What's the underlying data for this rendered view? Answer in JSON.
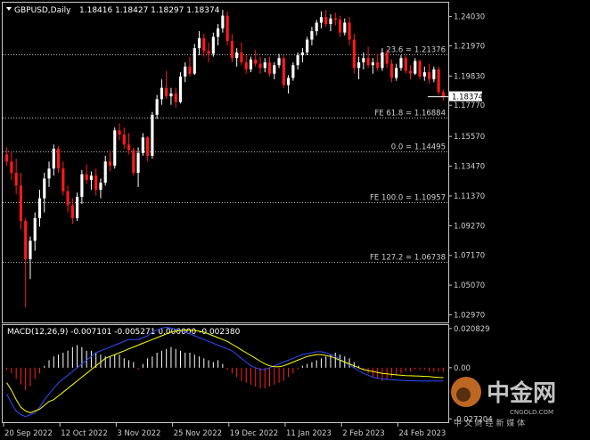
{
  "window": {
    "symbol_line": "GBPUSD,Daily",
    "ohlc": "1.18416 1.18427 1.18297 1.18374",
    "current_price": "1.18374"
  },
  "colors": {
    "background": "#000000",
    "bull_candle": "#ffffff",
    "bear_candle": "#ff1a1a",
    "grid": "#c8c8c8",
    "macd_hist_pos": "#ffffff",
    "macd_hist_neg": "#ff2020",
    "macd_signal": "#ffff00",
    "macd_line": "#2a4dff",
    "fib_line": "#bdbdbd"
  },
  "price_axis": {
    "ticks": [
      "1.24030",
      "1.21970",
      "1.19830",
      "1.17770",
      "1.15570",
      "1.13470",
      "1.11370",
      "1.09270",
      "1.07170",
      "1.05070",
      "1.02970"
    ],
    "range": [
      1.025,
      1.2495
    ]
  },
  "levels": [
    {
      "label": "23.6 = 1.21376",
      "value": 1.21376
    },
    {
      "label": "FE 61.8 = 1.16884",
      "value": 1.16884
    },
    {
      "label": "0.0 = 1.14495",
      "value": 1.14495
    },
    {
      "label": "FE 100.0 = 1.10957",
      "value": 1.10957
    },
    {
      "label": "FE 127.2 = 1.06738",
      "value": 1.06738
    }
  ],
  "macd": {
    "label": "MACD(12,26,9) -0.007101 -0.005271 0.000000 -0.002380",
    "ticks": [
      "0.020829",
      "0.00",
      "-0.027204"
    ],
    "range": [
      -0.0285,
      0.0222
    ]
  },
  "time_axis": {
    "labels": [
      "20 Sep 2022",
      "12 Oct 2022",
      "3 Nov 2022",
      "25 Nov 2022",
      "19 Dec 2022",
      "11 Jan 2023",
      "2 Feb 2023",
      "24 Feb 2023"
    ]
  },
  "watermark": {
    "logo_text": "中金网",
    "url_text": "CNGOLD.COM",
    "sub_text": "中 文 财 经 新 媒 体"
  },
  "chart_data": {
    "type": "candlestick",
    "bars": [
      [
        1.143,
        1.148,
        1.135,
        1.138
      ],
      [
        1.138,
        1.145,
        1.125,
        1.13
      ],
      [
        1.13,
        1.14,
        1.115,
        1.121
      ],
      [
        1.121,
        1.13,
        1.09,
        1.096
      ],
      [
        1.096,
        1.098,
        1.035,
        1.069
      ],
      [
        1.069,
        1.085,
        1.055,
        1.082
      ],
      [
        1.082,
        1.102,
        1.075,
        1.098
      ],
      [
        1.098,
        1.118,
        1.092,
        1.112
      ],
      [
        1.112,
        1.13,
        1.102,
        1.126
      ],
      [
        1.126,
        1.138,
        1.12,
        1.133
      ],
      [
        1.133,
        1.15,
        1.128,
        1.147
      ],
      [
        1.147,
        1.149,
        1.13,
        1.133
      ],
      [
        1.133,
        1.138,
        1.114,
        1.117
      ],
      [
        1.117,
        1.121,
        1.102,
        1.107
      ],
      [
        1.107,
        1.112,
        1.094,
        1.098
      ],
      [
        1.098,
        1.116,
        1.096,
        1.113
      ],
      [
        1.113,
        1.132,
        1.108,
        1.129
      ],
      [
        1.129,
        1.136,
        1.122,
        1.125
      ],
      [
        1.125,
        1.131,
        1.118,
        1.128
      ],
      [
        1.128,
        1.133,
        1.114,
        1.118
      ],
      [
        1.118,
        1.126,
        1.112,
        1.123
      ],
      [
        1.123,
        1.142,
        1.121,
        1.138
      ],
      [
        1.138,
        1.146,
        1.131,
        1.135
      ],
      [
        1.135,
        1.162,
        1.133,
        1.16
      ],
      [
        1.16,
        1.165,
        1.153,
        1.157
      ],
      [
        1.157,
        1.162,
        1.147,
        1.15
      ],
      [
        1.15,
        1.158,
        1.143,
        1.146
      ],
      [
        1.146,
        1.148,
        1.128,
        1.13
      ],
      [
        1.13,
        1.148,
        1.12,
        1.144
      ],
      [
        1.144,
        1.158,
        1.142,
        1.155
      ],
      [
        1.155,
        1.156,
        1.138,
        1.142
      ],
      [
        1.142,
        1.173,
        1.14,
        1.171
      ],
      [
        1.171,
        1.185,
        1.168,
        1.182
      ],
      [
        1.182,
        1.196,
        1.178,
        1.19
      ],
      [
        1.19,
        1.202,
        1.182,
        1.184
      ],
      [
        1.184,
        1.19,
        1.178,
        1.186
      ],
      [
        1.186,
        1.19,
        1.176,
        1.18
      ],
      [
        1.18,
        1.201,
        1.179,
        1.198
      ],
      [
        1.198,
        1.208,
        1.194,
        1.205
      ],
      [
        1.205,
        1.212,
        1.198,
        1.2
      ],
      [
        1.2,
        1.221,
        1.199,
        1.218
      ],
      [
        1.218,
        1.23,
        1.213,
        1.225
      ],
      [
        1.225,
        1.228,
        1.212,
        1.216
      ],
      [
        1.216,
        1.222,
        1.208,
        1.214
      ],
      [
        1.214,
        1.229,
        1.212,
        1.226
      ],
      [
        1.226,
        1.235,
        1.22,
        1.232
      ],
      [
        1.232,
        1.245,
        1.229,
        1.241
      ],
      [
        1.241,
        1.244,
        1.22,
        1.223
      ],
      [
        1.223,
        1.228,
        1.208,
        1.211
      ],
      [
        1.211,
        1.218,
        1.205,
        1.215
      ],
      [
        1.215,
        1.222,
        1.206,
        1.208
      ],
      [
        1.208,
        1.213,
        1.2,
        1.203
      ],
      [
        1.203,
        1.212,
        1.201,
        1.21
      ],
      [
        1.21,
        1.217,
        1.205,
        1.207
      ],
      [
        1.207,
        1.212,
        1.2,
        1.204
      ],
      [
        1.204,
        1.211,
        1.201,
        1.208
      ],
      [
        1.208,
        1.212,
        1.198,
        1.2
      ],
      [
        1.2,
        1.208,
        1.196,
        1.206
      ],
      [
        1.206,
        1.214,
        1.204,
        1.211
      ],
      [
        1.211,
        1.213,
        1.19,
        1.192
      ],
      [
        1.192,
        1.199,
        1.186,
        1.197
      ],
      [
        1.197,
        1.208,
        1.195,
        1.206
      ],
      [
        1.206,
        1.215,
        1.203,
        1.213
      ],
      [
        1.213,
        1.218,
        1.208,
        1.215
      ],
      [
        1.215,
        1.226,
        1.213,
        1.224
      ],
      [
        1.224,
        1.233,
        1.22,
        1.23
      ],
      [
        1.23,
        1.238,
        1.227,
        1.236
      ],
      [
        1.236,
        1.244,
        1.232,
        1.24
      ],
      [
        1.24,
        1.245,
        1.233,
        1.235
      ],
      [
        1.235,
        1.242,
        1.23,
        1.239
      ],
      [
        1.239,
        1.243,
        1.234,
        1.238
      ],
      [
        1.238,
        1.241,
        1.226,
        1.229
      ],
      [
        1.229,
        1.239,
        1.227,
        1.236
      ],
      [
        1.236,
        1.24,
        1.22,
        1.224
      ],
      [
        1.224,
        1.228,
        1.2,
        1.204
      ],
      [
        1.204,
        1.212,
        1.196,
        1.208
      ],
      [
        1.208,
        1.215,
        1.203,
        1.211
      ],
      [
        1.211,
        1.219,
        1.204,
        1.206
      ],
      [
        1.206,
        1.211,
        1.2,
        1.208
      ],
      [
        1.208,
        1.214,
        1.202,
        1.204
      ],
      [
        1.204,
        1.218,
        1.202,
        1.215
      ],
      [
        1.215,
        1.217,
        1.204,
        1.207
      ],
      [
        1.207,
        1.21,
        1.194,
        1.197
      ],
      [
        1.197,
        1.207,
        1.195,
        1.204
      ],
      [
        1.204,
        1.213,
        1.202,
        1.211
      ],
      [
        1.211,
        1.213,
        1.2,
        1.202
      ],
      [
        1.202,
        1.206,
        1.196,
        1.2
      ],
      [
        1.2,
        1.211,
        1.199,
        1.209
      ],
      [
        1.209,
        1.21,
        1.196,
        1.198
      ],
      [
        1.198,
        1.205,
        1.195,
        1.201
      ],
      [
        1.201,
        1.207,
        1.193,
        1.196
      ],
      [
        1.196,
        1.205,
        1.194,
        1.203
      ],
      [
        1.203,
        1.205,
        1.185,
        1.187
      ],
      [
        1.187,
        1.189,
        1.181,
        1.1837
      ]
    ],
    "macd_histogram": [
      -0.001,
      -0.003,
      -0.006,
      -0.009,
      -0.012,
      -0.01,
      -0.006,
      -0.003,
      0.001,
      0.004,
      0.006,
      0.007,
      0.008,
      0.009,
      0.011,
      0.012,
      0.011,
      0.009,
      0.009,
      0.008,
      0.007,
      0.006,
      0.006,
      0.007,
      0.007,
      0.005,
      0.004,
      0.003,
      -0.001,
      0.002,
      0.005,
      0.006,
      0.008,
      0.009,
      0.01,
      0.011,
      0.01,
      0.009,
      0.008,
      0.008,
      0.007,
      0.006,
      0.005,
      0.004,
      0.003,
      0.004,
      0.002,
      -0.001,
      -0.003,
      -0.005,
      -0.007,
      -0.008,
      -0.009,
      -0.01,
      -0.011,
      -0.011,
      -0.01,
      -0.009,
      -0.008,
      -0.007,
      -0.005,
      -0.003,
      -0.001,
      0.001,
      0.002,
      0.003,
      0.004,
      0.005,
      0.006,
      0.007,
      0.008,
      0.007,
      0.006,
      0.005,
      0.003,
      0.001,
      -0.001,
      -0.003,
      -0.005,
      -0.006,
      -0.007,
      -0.006,
      -0.005,
      -0.004,
      -0.003,
      -0.002,
      -0.002,
      -0.001,
      -0.001,
      -0.001,
      -0.002,
      -0.002,
      -0.002,
      -0.002
    ],
    "macd_signal": [
      -0.008,
      -0.012,
      -0.017,
      -0.021,
      -0.023,
      -0.024,
      -0.023,
      -0.022,
      -0.02,
      -0.018,
      -0.017,
      -0.015,
      -0.013,
      -0.011,
      -0.009,
      -0.007,
      -0.005,
      -0.003,
      -0.001,
      0.001,
      0.003,
      0.005,
      0.006,
      0.007,
      0.008,
      0.009,
      0.01,
      0.011,
      0.012,
      0.013,
      0.014,
      0.015,
      0.016,
      0.017,
      0.018,
      0.019,
      0.0195,
      0.0198,
      0.02,
      0.02,
      0.0198,
      0.0195,
      0.019,
      0.018,
      0.017,
      0.016,
      0.015,
      0.014,
      0.0125,
      0.011,
      0.0095,
      0.008,
      0.0065,
      0.005,
      0.0035,
      0.002,
      0.001,
      0.0005,
      0.0005,
      0.001,
      0.002,
      0.003,
      0.004,
      0.005,
      0.006,
      0.0065,
      0.007,
      0.007,
      0.0065,
      0.006,
      0.005,
      0.004,
      0.003,
      0.002,
      0.001,
      0.0,
      -0.001,
      -0.0015,
      -0.002,
      -0.0025,
      -0.003,
      -0.0033,
      -0.0036,
      -0.0038,
      -0.004,
      -0.0042,
      -0.0043,
      -0.0044,
      -0.0045,
      -0.0046,
      -0.0047,
      -0.005,
      -0.0052,
      -0.0053
    ],
    "macd_line": [
      -0.014,
      -0.019,
      -0.023,
      -0.025,
      -0.026,
      -0.025,
      -0.024,
      -0.021,
      -0.017,
      -0.014,
      -0.011,
      -0.008,
      -0.006,
      -0.004,
      -0.002,
      0.0,
      0.002,
      0.004,
      0.006,
      0.008,
      0.009,
      0.01,
      0.011,
      0.012,
      0.013,
      0.014,
      0.015,
      0.015,
      0.015,
      0.016,
      0.017,
      0.019,
      0.02,
      0.021,
      0.0215,
      0.021,
      0.0205,
      0.02,
      0.019,
      0.018,
      0.017,
      0.016,
      0.015,
      0.014,
      0.013,
      0.012,
      0.011,
      0.01,
      0.009,
      0.007,
      0.005,
      0.003,
      0.001,
      0.0,
      -0.001,
      -0.001,
      0.0,
      0.001,
      0.002,
      0.003,
      0.004,
      0.005,
      0.006,
      0.007,
      0.0075,
      0.008,
      0.0085,
      0.0085,
      0.008,
      0.007,
      0.006,
      0.0045,
      0.003,
      0.0015,
      0.0,
      -0.0015,
      -0.003,
      -0.004,
      -0.005,
      -0.0055,
      -0.006,
      -0.0062,
      -0.0064,
      -0.0066,
      -0.0067,
      -0.0068,
      -0.0069,
      -0.007,
      -0.0071,
      -0.0071,
      -0.0071,
      -0.0071,
      -0.0071,
      -0.0071
    ]
  }
}
